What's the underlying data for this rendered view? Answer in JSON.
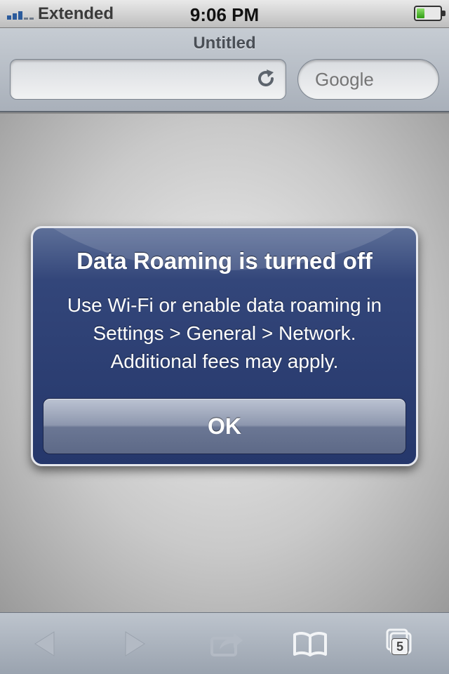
{
  "status_bar": {
    "carrier": "Extended",
    "time": "9:06 PM",
    "signal_bars": 3,
    "battery_level": 0.35
  },
  "browser": {
    "page_title": "Untitled",
    "url_value": "",
    "search_placeholder": "Google",
    "icons": {
      "reload": "reload-icon",
      "back": "back-arrow-icon",
      "forward": "forward-arrow-icon",
      "share": "share-icon",
      "bookmarks": "bookmarks-icon",
      "tabs": "tabs-icon"
    },
    "tab_count": "5"
  },
  "alert": {
    "title": "Data Roaming is turned off",
    "message_line1": "Use Wi-Fi or enable data roaming in",
    "message_line2": "Settings > General > Network.",
    "message_line3": "Additional fees may apply.",
    "ok_label": "OK"
  },
  "colors": {
    "alert_background": "#25376b",
    "toolbar_background": "#a9b0ba",
    "status_text": "#222222"
  }
}
